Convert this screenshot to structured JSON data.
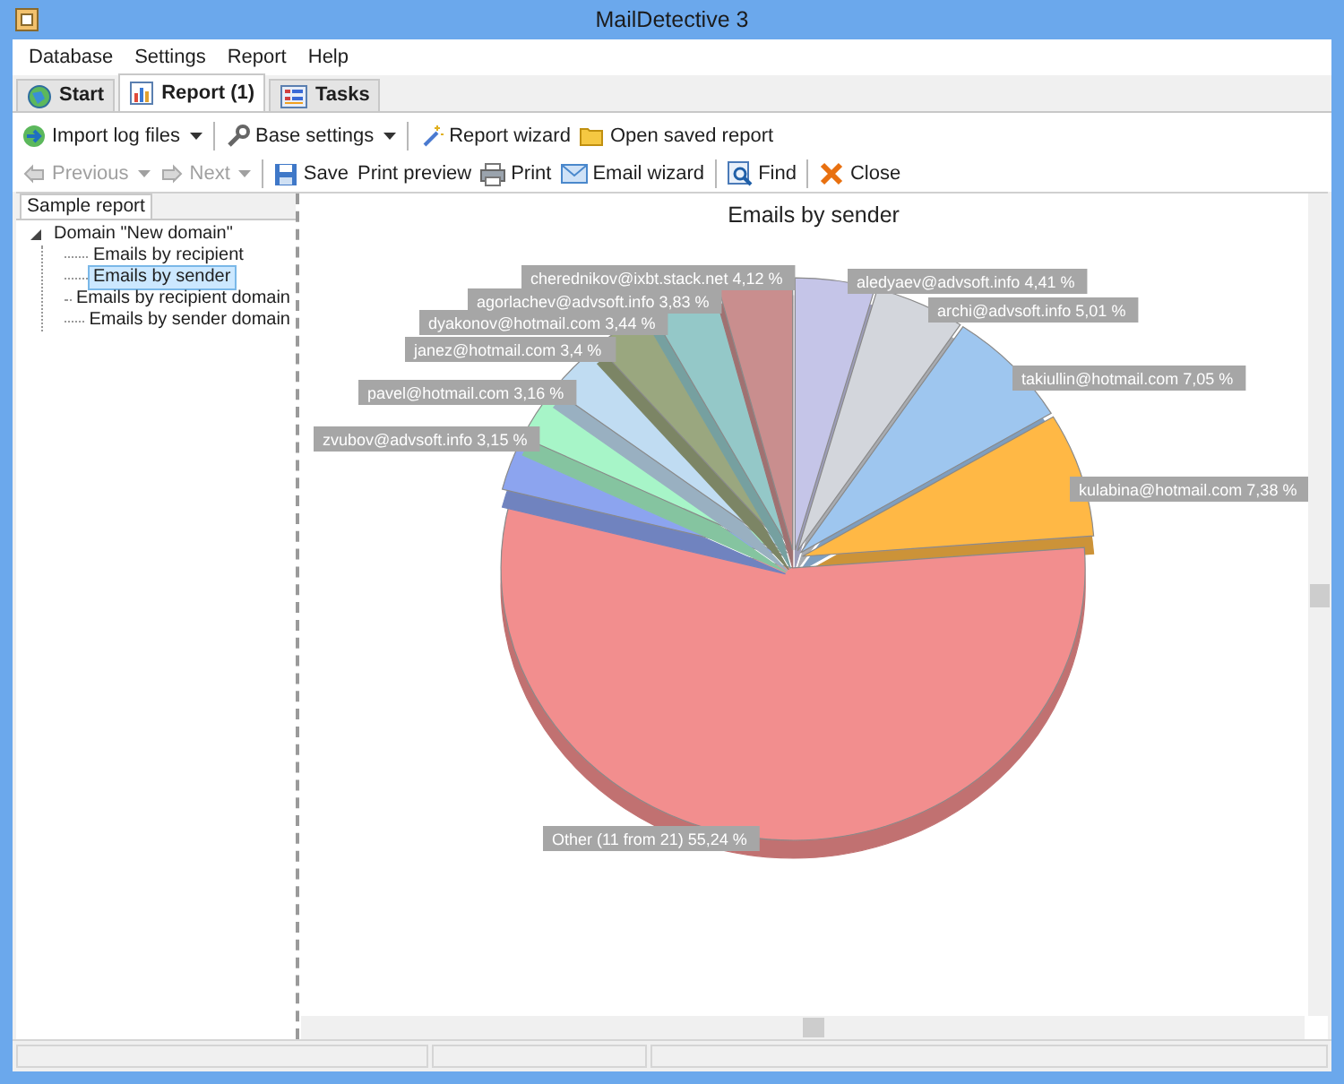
{
  "window": {
    "title": "MailDetective 3"
  },
  "menu": [
    "Database",
    "Settings",
    "Report",
    "Help"
  ],
  "tabs": [
    {
      "label": "Start",
      "selected": false
    },
    {
      "label": "Report (1)",
      "selected": true
    },
    {
      "label": "Tasks",
      "selected": false
    }
  ],
  "toolbar_rows": [
    [
      {
        "kind": "button",
        "label": "Import log files",
        "dropdown": true,
        "disabled": false
      },
      {
        "kind": "separator"
      },
      {
        "kind": "button",
        "label": "Base settings",
        "dropdown": true,
        "disabled": false
      },
      {
        "kind": "separator"
      },
      {
        "kind": "button",
        "label": "Report wizard",
        "dropdown": false,
        "disabled": false
      },
      {
        "kind": "button",
        "label": "Open saved report",
        "dropdown": false,
        "disabled": false
      }
    ],
    [
      {
        "kind": "button",
        "label": "Previous",
        "dropdown": true,
        "disabled": true
      },
      {
        "kind": "button",
        "label": "Next",
        "dropdown": true,
        "disabled": true
      },
      {
        "kind": "separator"
      },
      {
        "kind": "button",
        "label": "Save",
        "dropdown": false,
        "disabled": false
      },
      {
        "kind": "button",
        "label": "Print preview",
        "dropdown": false,
        "disabled": false
      },
      {
        "kind": "button",
        "label": "Print",
        "dropdown": false,
        "disabled": false
      },
      {
        "kind": "button",
        "label": "Email wizard",
        "dropdown": false,
        "disabled": false
      },
      {
        "kind": "separator"
      },
      {
        "kind": "button",
        "label": "Find",
        "dropdown": false,
        "disabled": false
      },
      {
        "kind": "separator"
      },
      {
        "kind": "button",
        "label": "Close",
        "dropdown": false,
        "disabled": false
      }
    ]
  ],
  "side_panel": {
    "tab": "Sample report",
    "tree": [
      {
        "label": "Domain \"New domain\"",
        "expanded": true,
        "selected": false,
        "children": [
          {
            "label": "Emails by recipient",
            "selected": false
          },
          {
            "label": "Emails by sender",
            "selected": true
          },
          {
            "label": "Emails by recipient domain",
            "selected": false
          },
          {
            "label": "Emails by sender domain",
            "selected": false
          }
        ]
      }
    ]
  },
  "report": {
    "chart_data": {
      "type": "pie",
      "title": "Emails by sender",
      "categories": [
        "aledyaev@advsoft.info",
        "archi@advsoft.info",
        "takiullin@hotmail.com",
        "kulabina@hotmail.com",
        "Other (11 from 21)",
        "zvubov@advsoft.info",
        "pavel@hotmail.com",
        "janez@hotmail.com",
        "dyakonov@hotmail.com",
        "agorlachev@advsoft.info",
        "cherednikov@ixbt.stack.net"
      ],
      "values": [
        4.41,
        5.01,
        7.05,
        7.38,
        55.24,
        3.15,
        3.16,
        3.4,
        3.44,
        3.83,
        4.12
      ],
      "colors": [
        "#c5c5e8",
        "#d3d6dc",
        "#9ec6ef",
        "#ffb845",
        "#f28e8e",
        "#8ca4ef",
        "#a7f5c8",
        "#c0dcf2",
        "#9aa77f",
        "#94c8c8",
        "#c98e8e"
      ],
      "value_labels": [
        "4,41 %",
        "5,01 %",
        "7,05 %",
        "7,38 %",
        "55,24 %",
        "3,15 %",
        "3,16 %",
        "3,4 %",
        "3,44 %",
        "3,83 %",
        "4,12 %"
      ]
    }
  }
}
